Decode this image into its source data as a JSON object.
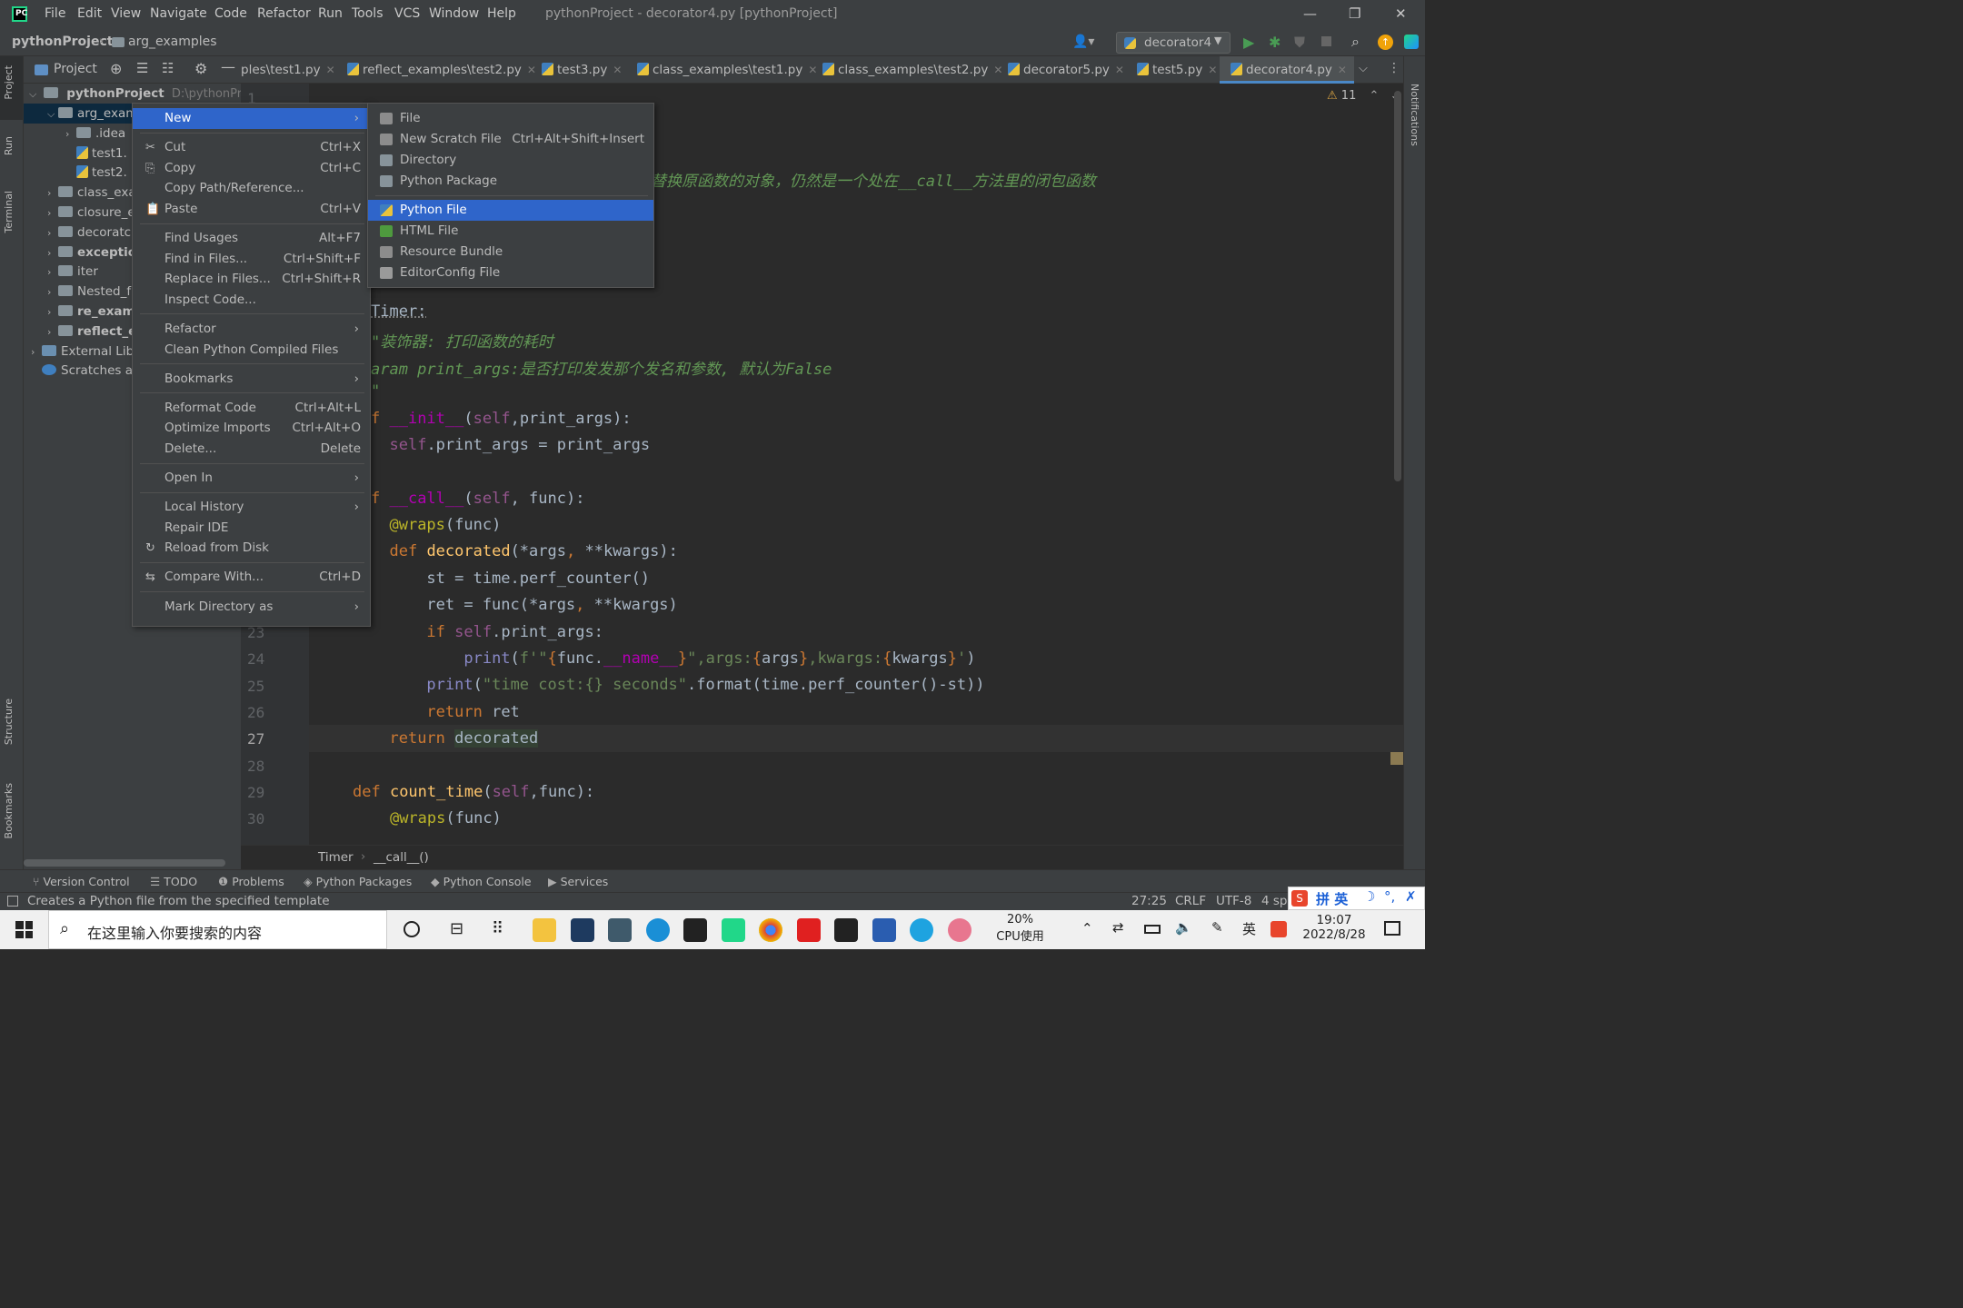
{
  "titlebar": {
    "menus": [
      "File",
      "Edit",
      "View",
      "Navigate",
      "Code",
      "Refactor",
      "Run",
      "Tools",
      "VCS",
      "Window",
      "Help"
    ],
    "title": "pythonProject - decorator4.py [pythonProject]"
  },
  "navbar": {
    "project": "pythonProject",
    "folder": "arg_examples",
    "run_config": "decorator4"
  },
  "left_strip": {
    "project": "Project",
    "run": "Run",
    "terminal": "Terminal",
    "structure": "Structure",
    "bookmarks": "Bookmarks"
  },
  "right_strip": {
    "notifications": "Notifications"
  },
  "project_panel": {
    "title": "Project",
    "root": "pythonProject",
    "root_path": "D:\\pythonProje",
    "rows": [
      {
        "label": "arg_exam",
        "indent": 1,
        "expanded": true,
        "bold": false,
        "type": "folder"
      },
      {
        "label": ".idea",
        "indent": 2,
        "type": "folder"
      },
      {
        "label": "test1.",
        "indent": 2,
        "type": "py"
      },
      {
        "label": "test2.",
        "indent": 2,
        "type": "py"
      },
      {
        "label": "class_exa",
        "indent": 1,
        "type": "folder"
      },
      {
        "label": "closure_e",
        "indent": 1,
        "type": "folder"
      },
      {
        "label": "decoratc",
        "indent": 1,
        "type": "folder"
      },
      {
        "label": "exceptio",
        "indent": 1,
        "type": "folder",
        "bold": true
      },
      {
        "label": "iter",
        "indent": 1,
        "type": "folder"
      },
      {
        "label": "Nested_f",
        "indent": 1,
        "type": "folder"
      },
      {
        "label": "re_exam",
        "indent": 1,
        "type": "folder",
        "bold": true
      },
      {
        "label": "reflect_e",
        "indent": 1,
        "type": "folder",
        "bold": true
      },
      {
        "label": "External Lib",
        "indent": 0,
        "type": "lib"
      },
      {
        "label": "Scratches ar",
        "indent": 0,
        "type": "scratch"
      }
    ]
  },
  "tabs": [
    "ples\\test1.py",
    "reflect_examples\\test2.py",
    "test3.py",
    "class_examples\\test1.py",
    "class_examples\\test2.py",
    "decorator5.py",
    "test5.py",
    "decorator4.py"
  ],
  "editor": {
    "warnings": "11",
    "comment_line": "替换原函数的对象，仍然是一个处在__call__方法里的闭包函数",
    "lines": [
      {
        "n": "24",
        "code": ""
      },
      {
        "n": "25",
        "code": ""
      },
      {
        "n": "26",
        "code": ""
      },
      {
        "n": "27",
        "code": ""
      },
      {
        "n": "28",
        "code": ""
      },
      {
        "n": "29",
        "code": ""
      },
      {
        "n": "30",
        "code": ""
      }
    ]
  },
  "context_menu": [
    {
      "label": "New",
      "sub": true,
      "selected": true
    },
    {
      "sep": true
    },
    {
      "label": "Cut",
      "sc": "Ctrl+X",
      "icon": "scissors-icon"
    },
    {
      "label": "Copy",
      "sc": "Ctrl+C",
      "icon": "copy-icon"
    },
    {
      "label": "Copy Path/Reference..."
    },
    {
      "label": "Paste",
      "sc": "Ctrl+V",
      "icon": "paste-icon"
    },
    {
      "sep": true
    },
    {
      "label": "Find Usages",
      "sc": "Alt+F7"
    },
    {
      "label": "Find in Files...",
      "sc": "Ctrl+Shift+F"
    },
    {
      "label": "Replace in Files...",
      "sc": "Ctrl+Shift+R"
    },
    {
      "label": "Inspect Code..."
    },
    {
      "sep": true
    },
    {
      "label": "Refactor",
      "sub": true
    },
    {
      "label": "Clean Python Compiled Files"
    },
    {
      "sep": true
    },
    {
      "label": "Bookmarks",
      "sub": true
    },
    {
      "sep": true
    },
    {
      "label": "Reformat Code",
      "sc": "Ctrl+Alt+L"
    },
    {
      "label": "Optimize Imports",
      "sc": "Ctrl+Alt+O"
    },
    {
      "label": "Delete...",
      "sc": "Delete"
    },
    {
      "sep": true
    },
    {
      "label": "Open In",
      "sub": true
    },
    {
      "sep": true
    },
    {
      "label": "Local History",
      "sub": true
    },
    {
      "label": "Repair IDE"
    },
    {
      "label": "Reload from Disk",
      "icon": "reload-icon"
    },
    {
      "sep": true
    },
    {
      "label": "Compare With...",
      "sc": "Ctrl+D",
      "icon": "compare-icon"
    },
    {
      "sep": true
    },
    {
      "label": "Mark Directory as",
      "sub": true
    }
  ],
  "submenu": [
    {
      "label": "File",
      "icon": "#8c8c8c"
    },
    {
      "label": "New Scratch File",
      "sc": "Ctrl+Alt+Shift+Insert",
      "icon": "#8c8c8c"
    },
    {
      "label": "Directory",
      "icon": "#87939a"
    },
    {
      "label": "Python Package",
      "icon": "#87939a"
    },
    {
      "sep": true
    },
    {
      "label": "Python File",
      "selected": true,
      "icon": "py"
    },
    {
      "label": "HTML File",
      "icon": "#4e9a3e"
    },
    {
      "label": "Resource Bundle",
      "icon": "#8c8c8c"
    },
    {
      "label": "EditorConfig File",
      "icon": "#9a9a9a"
    }
  ],
  "breadcrumb": {
    "class": "Timer",
    "method": "__call__()"
  },
  "toolwindows": [
    "Version Control",
    "TODO",
    "Problems",
    "Python Packages",
    "Python Console",
    "Services"
  ],
  "status": {
    "message": "Creates a Python file from the specified template",
    "pos": "27:25",
    "eol": "CRLF",
    "enc": "UTF-8",
    "indent": "4 sp"
  },
  "ime": {
    "label": "拼 英"
  },
  "taskbar": {
    "search": "在这里输入你要搜索的内容",
    "cpu": "20%",
    "cpu_label": "CPU使用",
    "time": "19:07",
    "date": "2022/8/28",
    "ime": "英"
  },
  "colors": {
    "selection": "#2f65ca",
    "background": "#2b2b2b",
    "panel": "#3c3f41"
  }
}
